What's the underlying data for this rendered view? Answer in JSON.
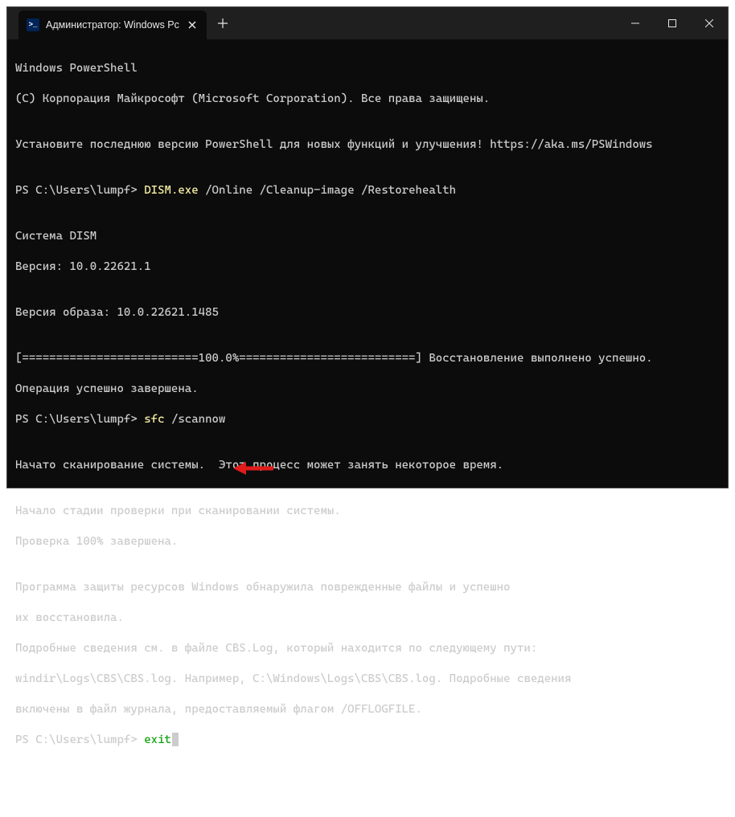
{
  "tab": {
    "title": "Администратор: Windows Pc"
  },
  "colors": {
    "yellow": "#f9f1a5",
    "green": "#13a10e"
  },
  "terminal": {
    "l1": "Windows PowerShell",
    "l2": "(C) Корпорация Майкрософт (Microsoft Corporation). Все права защищены.",
    "l3": "",
    "l4": "Установите последнюю версию PowerShell для новых функций и улучшения! https://aka.ms/PSWindows",
    "l5": "",
    "prompt1": "PS C:\\Users\\lumpf> ",
    "cmd1": "DISM.exe",
    "cmd1args": " /Online /Cleanup-image /Restorehealth",
    "l7": "",
    "l8": "Cистема DISM",
    "l9": "Версия: 10.0.22621.1",
    "l10": "",
    "l11": "Версия образа: 10.0.22621.1485",
    "l12": "",
    "l13": "[==========================100.0%==========================] Восстановление выполнено успешно.",
    "l14": "Операция успешно завершена.",
    "prompt2": "PS C:\\Users\\lumpf> ",
    "cmd2": "sfc",
    "cmd2args": " /scannow",
    "l16": "",
    "l17": "Начато сканирование системы.  Этот процесс может занять некоторое время.",
    "l18": "",
    "l19": "Начало стадии проверки при сканировании системы.",
    "l20": "Проверка 100% завершена.",
    "l21": "",
    "l22": "Программа защиты ресурсов Windows обнаружила поврежденные файлы и успешно",
    "l23": "их восстановила.",
    "l24": "Подробные сведения см. в файле CBS.Log, который находится по следующему пути:",
    "l25": "windir\\Logs\\CBS\\CBS.log. Например, C:\\Windows\\Logs\\CBS\\CBS.log. Подробные сведения",
    "l26": "включены в файл журнала, предоставляемый флагом /OFFLOGFILE.",
    "prompt3": "PS C:\\Users\\lumpf> ",
    "cmd3": "exit"
  }
}
